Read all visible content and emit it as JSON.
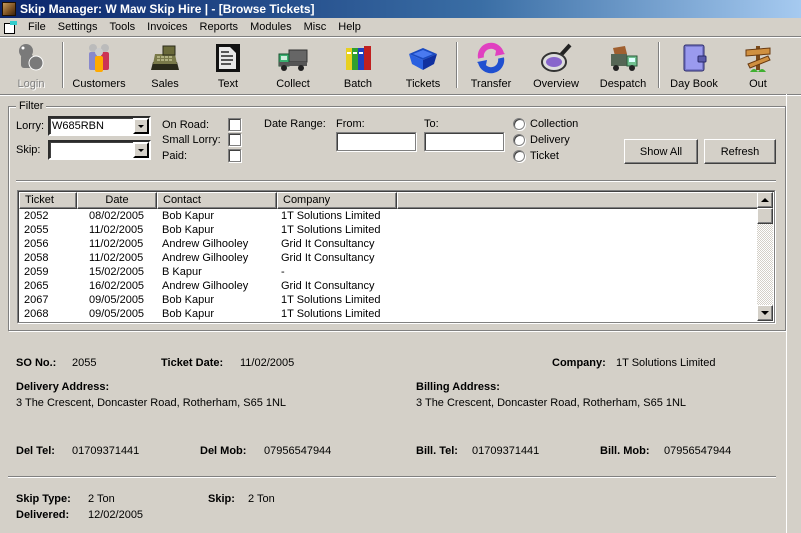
{
  "window": {
    "title": "Skip Manager: W Maw Skip Hire   | - [Browse Tickets]"
  },
  "menu": [
    "File",
    "Settings",
    "Tools",
    "Invoices",
    "Reports",
    "Modules",
    "Misc",
    "Help"
  ],
  "toolbar": [
    {
      "label": "Login",
      "icon": "login-icon",
      "enabled": false
    },
    {
      "label": "Customers",
      "icon": "customers-icon",
      "enabled": true
    },
    {
      "label": "Sales",
      "icon": "cash-register-icon",
      "enabled": true
    },
    {
      "label": "Text",
      "icon": "text-document-icon",
      "enabled": true
    },
    {
      "label": "Collect",
      "icon": "collect-truck-icon",
      "enabled": true
    },
    {
      "label": "Batch",
      "icon": "binders-icon",
      "enabled": true
    },
    {
      "label": "Tickets",
      "icon": "skip-bin-icon",
      "enabled": true
    },
    {
      "label": "Transfer",
      "icon": "transfer-arrows-icon",
      "enabled": true
    },
    {
      "label": "Overview",
      "icon": "magnifier-icon",
      "enabled": true
    },
    {
      "label": "Despatch",
      "icon": "despatch-truck-icon",
      "enabled": true
    },
    {
      "label": "Day Book",
      "icon": "day-book-icon",
      "enabled": true
    },
    {
      "label": "Out",
      "icon": "signpost-icon",
      "enabled": true
    }
  ],
  "filter": {
    "legend": "Filter",
    "lorry_label": "Lorry:",
    "lorry_value": "W685RBN",
    "skip_label": "Skip:",
    "skip_value": "",
    "on_road_label": "On Road:",
    "small_lorry_label": "Small Lorry:",
    "paid_label": "Paid:",
    "date_range_label": "Date Range:",
    "from_label": "From:",
    "from_value": "",
    "to_label": "To:",
    "to_value": "",
    "radio_options": [
      "Collection",
      "Delivery",
      "Ticket"
    ],
    "show_all_label": "Show All",
    "refresh_label": "Refresh"
  },
  "tickets": {
    "columns": [
      "Ticket",
      "Date",
      "Contact",
      "Company",
      ""
    ],
    "rows": [
      [
        "2052",
        "08/02/2005",
        "Bob Kapur",
        "1T Solutions Limited"
      ],
      [
        "2055",
        "11/02/2005",
        "Bob Kapur",
        "1T Solutions Limited"
      ],
      [
        "2056",
        "11/02/2005",
        "Andrew Gilhooley",
        "Grid It Consultancy"
      ],
      [
        "2058",
        "11/02/2005",
        "Andrew Gilhooley",
        "Grid It Consultancy"
      ],
      [
        "2059",
        "15/02/2005",
        "B Kapur",
        "-"
      ],
      [
        "2065",
        "16/02/2005",
        "Andrew Gilhooley",
        "Grid It Consultancy"
      ],
      [
        "2067",
        "09/05/2005",
        "Bob Kapur",
        "1T Solutions Limited"
      ],
      [
        "2068",
        "09/05/2005",
        "Bob Kapur",
        "1T Solutions Limited"
      ]
    ]
  },
  "details": {
    "so_no_label": "SO No.:",
    "so_no": "2055",
    "ticket_date_label": "Ticket Date:",
    "ticket_date": "11/02/2005",
    "company_label": "Company:",
    "company": "1T Solutions Limited",
    "delivery_address_label": "Delivery Address:",
    "delivery_address": "3 The Crescent, Doncaster Road, Rotherham, S65 1NL",
    "billing_address_label": "Billing Address:",
    "billing_address": "3 The Crescent, Doncaster Road, Rotherham, S65 1NL",
    "del_tel_label": "Del Tel:",
    "del_tel": "01709371441",
    "del_mob_label": "Del Mob:",
    "del_mob": "07956547944",
    "bill_tel_label": "Bill. Tel:",
    "bill_tel": "01709371441",
    "bill_mob_label": "Bill. Mob:",
    "bill_mob": "07956547944",
    "skip_type_label": "Skip Type:",
    "skip_type": "2 Ton",
    "skip_label": "Skip:",
    "skip": "2 Ton",
    "delivered_label": "Delivered:",
    "delivered": "12/02/2005"
  }
}
